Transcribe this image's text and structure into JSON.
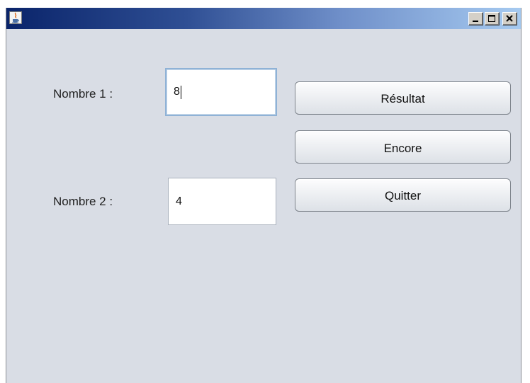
{
  "window": {
    "title": "",
    "icon": "java-icon",
    "controls": {
      "minimize": "minimize-icon",
      "maximize": "maximize-icon",
      "close": "close-icon"
    }
  },
  "form": {
    "nombre1": {
      "label": "Nombre 1 :",
      "value": "8",
      "focused": true
    },
    "nombre2": {
      "label": "Nombre 2 :",
      "value": "4",
      "focused": false
    }
  },
  "buttons": {
    "resultat": "Résultat",
    "encore": "Encore",
    "quitter": "Quitter"
  },
  "colors": {
    "titlebar_start": "#0a246a",
    "titlebar_end": "#a6caf0",
    "panel_background": "#d9dde5",
    "focus_border": "#8fb2d6"
  }
}
